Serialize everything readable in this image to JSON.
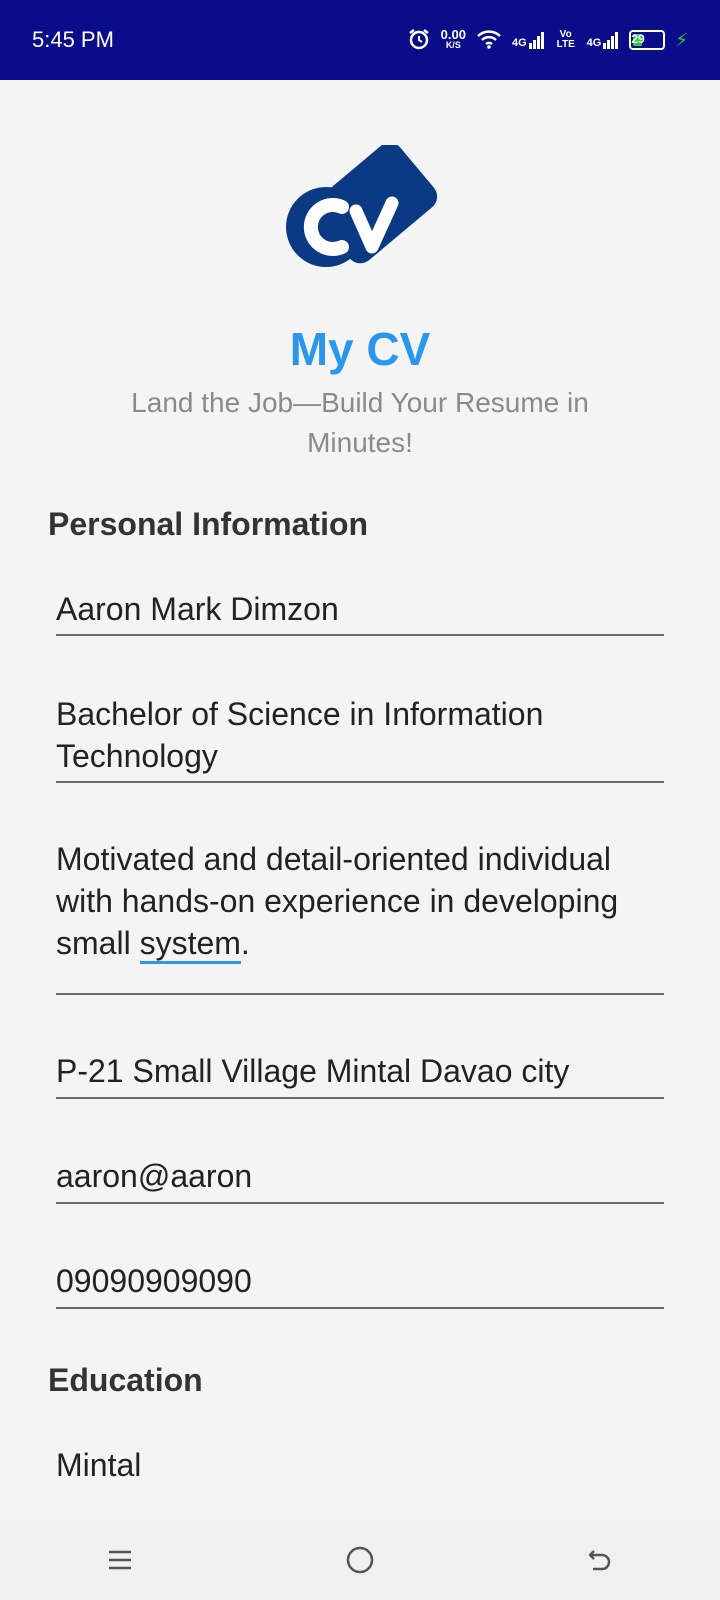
{
  "status_bar": {
    "time": "5:45 PM",
    "net_speed": "0.00",
    "net_unit": "K/S",
    "signal1": "4G",
    "volte": "Vo LTE",
    "signal2": "4G",
    "battery": "29"
  },
  "header": {
    "title": "My CV",
    "subtitle": "Land the Job—Build Your Resume in Minutes!"
  },
  "personal": {
    "heading": "Personal Information",
    "name": "Aaron Mark Dimzon",
    "degree": "Bachelor of Science in Information Technology",
    "summary_pre": "Motivated and detail-oriented individual with hands-on experience in developing small ",
    "summary_misspelled": "system",
    "summary_post": ".",
    "address": "P-21 Small Village Mintal Davao city",
    "email": "aaron@aaron",
    "phone": "09090909090"
  },
  "education": {
    "heading": "Education",
    "school": "Mintal"
  },
  "colors": {
    "status_bar_bg": "#0a0d8a",
    "title": "#2b97ec",
    "logo": "#0b3a84"
  },
  "icons": {
    "alarm": "alarm-icon",
    "wifi": "wifi-icon",
    "signal": "signal-icon",
    "battery": "battery-icon",
    "charging": "charging-bolt-icon",
    "nav_menu": "menu-icon",
    "nav_home": "home-circle-icon",
    "nav_back": "back-icon"
  }
}
